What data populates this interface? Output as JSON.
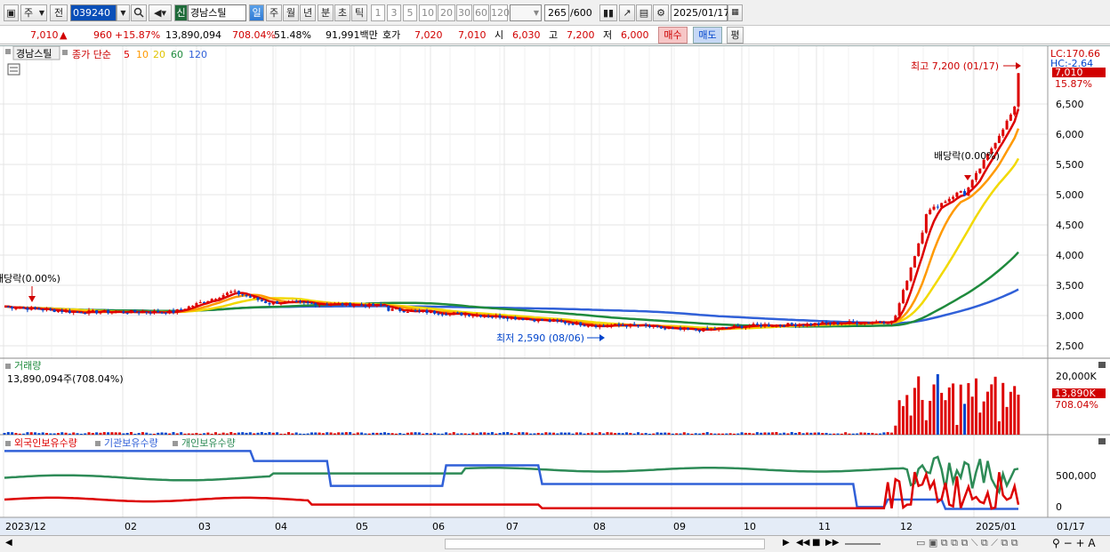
{
  "toolbar": {
    "market_type": "주",
    "prev_label": "전",
    "stock_code": "039240",
    "new_badge": "신",
    "stock_name": "경남스틸",
    "periods": [
      "일",
      "주",
      "월",
      "년",
      "분",
      "초",
      "틱"
    ],
    "intervals": [
      "1",
      "3",
      "5",
      "10",
      "20",
      "30",
      "60",
      "120"
    ],
    "count": "265",
    "count_total": "/600",
    "date": "2025/01/17"
  },
  "quote": {
    "price": "7,010",
    "arrow": "▲",
    "change": "960",
    "change_pct": "+15.87%",
    "volume": "13,890,094",
    "volume_ratio": "708.04%",
    "turnover": "51.48%",
    "amount": "91,991백만",
    "hoga_label": "호가",
    "ask": "7,020",
    "bid": "7,010",
    "open_label": "시",
    "open": "6,030",
    "high_label": "고",
    "high": "7,200",
    "low_label": "저",
    "low": "6,000",
    "buy_label": "매수",
    "sell_label": "매도",
    "eval_label": "평"
  },
  "price_panel": {
    "stock_label": "경남스틸",
    "ma_label": "종가 단순",
    "ma_periods": [
      "5",
      "10",
      "20",
      "60",
      "120"
    ],
    "ma_colors": [
      "#dd0000",
      "#ff9900",
      "#f2d900",
      "#1e8a3c",
      "#3060d8"
    ],
    "lc": "LC:170.66",
    "hc": "HC:-2.64",
    "current_price_tag": "7,010",
    "current_pct_tag": "15.87%",
    "high_note": "최고 7,200 (01/17)",
    "low_note": "최저 2,590 (08/06)",
    "dividend_note_right": "배당락(0.00%)",
    "dividend_note_left": "배당락(0.00%)",
    "y_ticks": [
      "6,500",
      "6,000",
      "5,500",
      "5,000",
      "4,500",
      "4,000",
      "3,500",
      "3,000",
      "2,500"
    ]
  },
  "volume_panel": {
    "title": "거래량",
    "value": "13,890,094주(708.04%)",
    "tick": "20,000K",
    "tag_value": "13,890K",
    "tag_pct": "708.04%"
  },
  "holding_panel": {
    "legend": [
      "외국인보유수량",
      "기관보유수량",
      "개인보유수량"
    ],
    "legend_colors": [
      "#dd0000",
      "#3060d8",
      "#2e8b57"
    ],
    "ticks": [
      "500,000",
      "0"
    ]
  },
  "x_axis": [
    "2023/12",
    "02",
    "03",
    "04",
    "05",
    "06",
    "07",
    "08",
    "09",
    "10",
    "11",
    "12",
    "2025/01",
    "01/17"
  ]
}
